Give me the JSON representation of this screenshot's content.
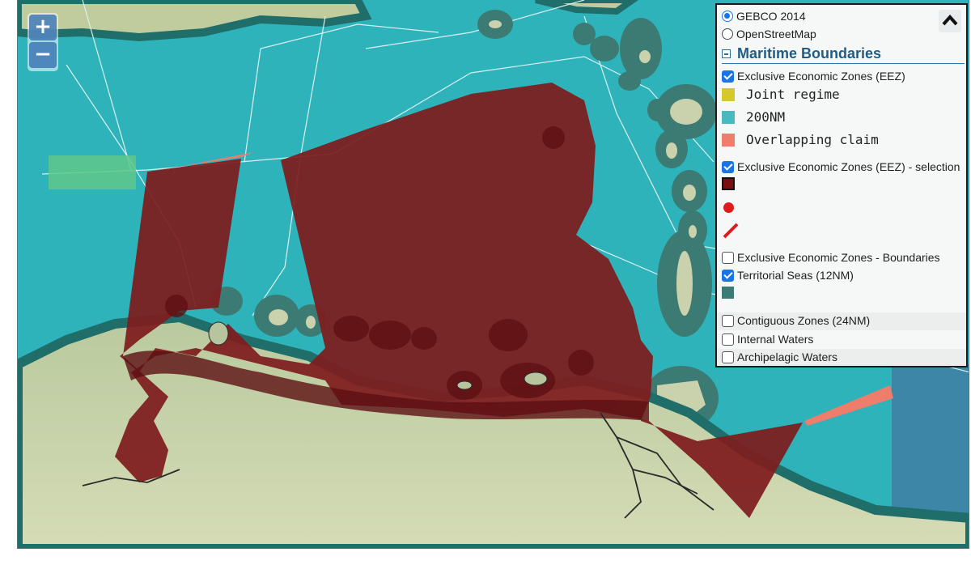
{
  "basemap_options": [
    {
      "label": "GEBCO 2014",
      "selected": true
    },
    {
      "label": "OpenStreetMap",
      "selected": false
    }
  ],
  "section": {
    "title": "Maritime Boundaries"
  },
  "layers": {
    "eez": {
      "label": "Exclusive Economic Zones (EEZ)",
      "checked": true
    },
    "eez_selection": {
      "label": "Exclusive Economic Zones (EEZ) - selection",
      "checked": true
    },
    "eez_boundaries": {
      "label": "Exclusive Economic Zones - Boundaries",
      "checked": false
    },
    "territorial_seas": {
      "label": "Territorial Seas (12NM)",
      "checked": true
    },
    "contiguous_zones": {
      "label": "Contiguous Zones (24NM)",
      "checked": false
    },
    "internal_waters": {
      "label": "Internal Waters",
      "checked": false
    },
    "archipelagic_waters": {
      "label": "Archipelagic Waters",
      "checked": false
    }
  },
  "eez_legend": [
    {
      "label": "Joint regime",
      "color": "#d4c82a"
    },
    {
      "label": "200NM",
      "color": "#47b9bf"
    },
    {
      "label": "Overlapping claim",
      "color": "#ee7d6c"
    }
  ],
  "selection_legend": {
    "polygon_color": "#7a0f12",
    "point_color": "#e01b1b",
    "line_color": "#e01b1b"
  },
  "territorial_legend_color": "#3b7b73",
  "zoom": {
    "in": "+",
    "out": "−"
  },
  "colors": {
    "sea": "#2fb3bb",
    "deep_sea": "#3d86a8",
    "land": "#c8d4a8",
    "selection": "#7e1c1e",
    "panel_title": "#1f5c86"
  }
}
